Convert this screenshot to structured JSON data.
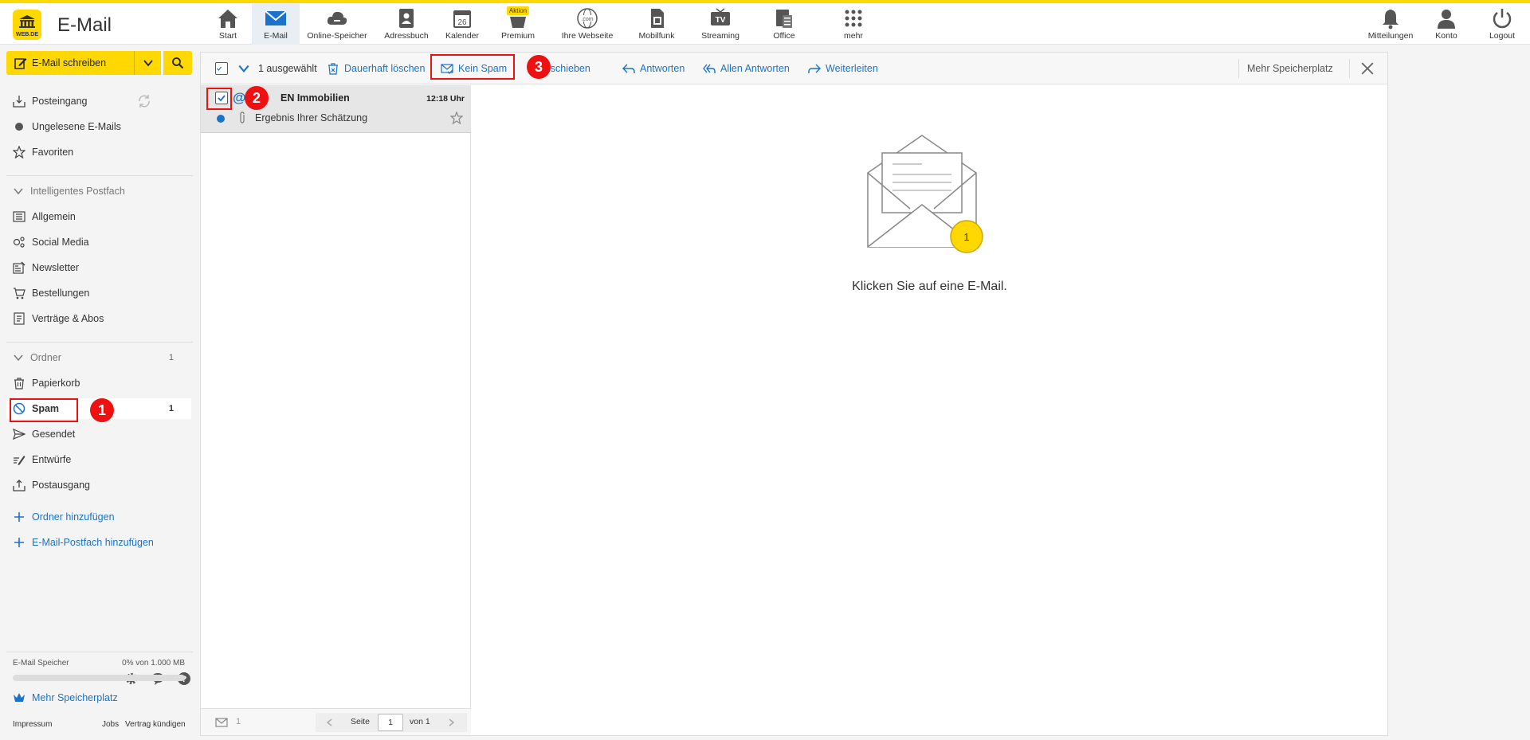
{
  "app": {
    "title": "E-Mail",
    "logo_text": "WEB.DE"
  },
  "nav": [
    {
      "label": "Start",
      "icon": "home-icon"
    },
    {
      "label": "E-Mail",
      "icon": "mail-icon"
    },
    {
      "label": "Online-Speicher",
      "icon": "cloud-icon"
    },
    {
      "label": "Adressbuch",
      "icon": "addressbook-icon"
    },
    {
      "label": "Kalender",
      "icon": "calendar-icon",
      "day": "26"
    },
    {
      "label": "Premium",
      "icon": "premium-icon",
      "badge": "Aktion"
    },
    {
      "label": "Ihre Webseite",
      "icon": "globe-icon",
      "sub": ".com"
    },
    {
      "label": "Mobilfunk",
      "icon": "sim-icon"
    },
    {
      "label": "Streaming",
      "icon": "tv-icon",
      "sub": "TV"
    },
    {
      "label": "Office",
      "icon": "office-icon"
    },
    {
      "label": "mehr",
      "icon": "grid-icon"
    }
  ],
  "rnav": [
    {
      "label": "Mitteilungen",
      "icon": "bell-icon"
    },
    {
      "label": "Konto",
      "icon": "user-icon"
    },
    {
      "label": "Logout",
      "icon": "power-icon"
    }
  ],
  "sidebar": {
    "compose_label": "E-Mail schreiben",
    "items_top": [
      {
        "label": "Posteingang",
        "icon": "inbox-icon"
      },
      {
        "label": "Ungelesene E-Mails",
        "icon": "dot-icon"
      },
      {
        "label": "Favoriten",
        "icon": "star-icon"
      }
    ],
    "smart_header": "Intelligentes Postfach",
    "smart_items": [
      {
        "label": "Allgemein",
        "icon": "list-icon"
      },
      {
        "label": "Social Media",
        "icon": "social-icon"
      },
      {
        "label": "Newsletter",
        "icon": "newsletter-icon"
      },
      {
        "label": "Bestellungen",
        "icon": "cart-icon"
      },
      {
        "label": "Verträge & Abos",
        "icon": "contract-icon"
      }
    ],
    "folder_header": "Ordner",
    "folder_count": "1",
    "folders": [
      {
        "label": "Papierkorb",
        "icon": "trash-icon"
      },
      {
        "label": "Spam",
        "icon": "spam-icon",
        "count": "1"
      },
      {
        "label": "Gesendet",
        "icon": "send-icon"
      },
      {
        "label": "Entwürfe",
        "icon": "draft-icon"
      },
      {
        "label": "Postausgang",
        "icon": "outbox-icon"
      }
    ],
    "add_folder": "Ordner hinzufügen",
    "add_mailbox": "E-Mail-Postfach hinzufügen",
    "storage_label": "E-Mail Speicher",
    "storage_value": "0% von 1.000 MB",
    "storage_fill": 0,
    "more_storage": "Mehr Speicherplatz",
    "footer": {
      "impressum": "Impressum",
      "jobs": "Jobs",
      "cancel": "Vertrag kündigen"
    }
  },
  "toolbar": {
    "selected": "1 ausgewählt",
    "delete": "Dauerhaft löschen",
    "not_spam": "Kein Spam",
    "move": "Verschieben",
    "reply": "Antworten",
    "reply_all": "Allen Antworten",
    "forward": "Weiterleiten",
    "more_storage": "Mehr Speicherplatz"
  },
  "mail": {
    "sender": "EN Immobilien",
    "time": "12:18 Uhr",
    "subject": "Ergebnis Ihrer Schätzung"
  },
  "list_footer": {
    "count": "1",
    "page_label": "Seite",
    "page": "1",
    "of": "von 1"
  },
  "preview": {
    "empty_text": "Klicken Sie auf eine E-Mail.",
    "badge": "1"
  },
  "steps": [
    "1",
    "2",
    "3"
  ],
  "colors": {
    "brand": "#ffd800",
    "link": "#1a73c8",
    "highlight": "#e11111"
  }
}
